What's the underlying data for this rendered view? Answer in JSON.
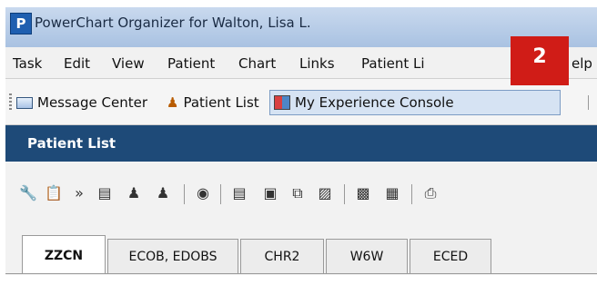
{
  "window": {
    "app_icon_letter": "P",
    "title": "PowerChart Organizer for Walton, Lisa L."
  },
  "menu": [
    "Task",
    "Edit",
    "View",
    "Patient",
    "Chart",
    "Links",
    "Patient Li",
    "elp"
  ],
  "annotation_badge": "2",
  "toolbar": {
    "message_center": "Message Center",
    "patient_list": "Patient List",
    "experience_console": "My Experience Console"
  },
  "panel": {
    "title": "Patient List"
  },
  "tabs": [
    "ZZCN",
    "ECOB, EDOBS",
    "CHR2",
    "W6W",
    "ECED"
  ],
  "active_tab": "ZZCN",
  "icons": [
    "wrench-icon",
    "properties-icon",
    "forward-icon",
    "document-list-icon",
    "add-person-icon",
    "remove-person-icon",
    "web-icon",
    "clipboard-list-icon",
    "clipboard-icon",
    "copy-icon",
    "paste-icon",
    "card-icon",
    "chart-table-icon",
    "print-icon"
  ],
  "colors": {
    "header_blue": "#1e4a78",
    "badge_red": "#d01c17",
    "titlebar": "#b8cde8"
  }
}
